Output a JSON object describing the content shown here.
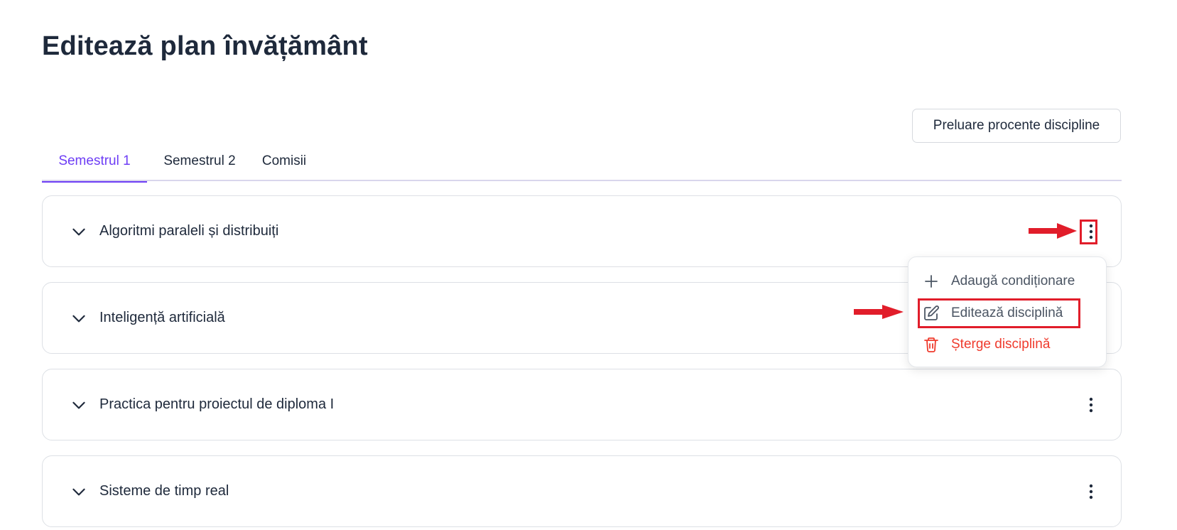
{
  "header": {
    "title": "Editează plan învățământ"
  },
  "toolbar": {
    "import_percentages_label": "Preluare procente discipline"
  },
  "tabs": [
    {
      "label": "Semestrul 1",
      "active": true
    },
    {
      "label": "Semestrul 2",
      "active": false
    },
    {
      "label": "Comisii",
      "active": false
    }
  ],
  "disciplines": [
    {
      "name": "Algoritmi paraleli și distribuiți"
    },
    {
      "name": "Inteligență artificială"
    },
    {
      "name": "Practica pentru proiectul de diploma I"
    },
    {
      "name": "Sisteme de timp real"
    }
  ],
  "context_menu": {
    "items": [
      {
        "label": "Adaugă condiționare",
        "icon": "plus-icon"
      },
      {
        "label": "Editează disciplină",
        "icon": "edit-icon"
      },
      {
        "label": "Șterge disciplină",
        "icon": "trash-icon"
      }
    ]
  },
  "colors": {
    "accent": "#6d3df5",
    "danger": "#ef3b2d",
    "annotation": "#e11d2a",
    "text": "#1e293b",
    "border": "#dde0e5"
  }
}
